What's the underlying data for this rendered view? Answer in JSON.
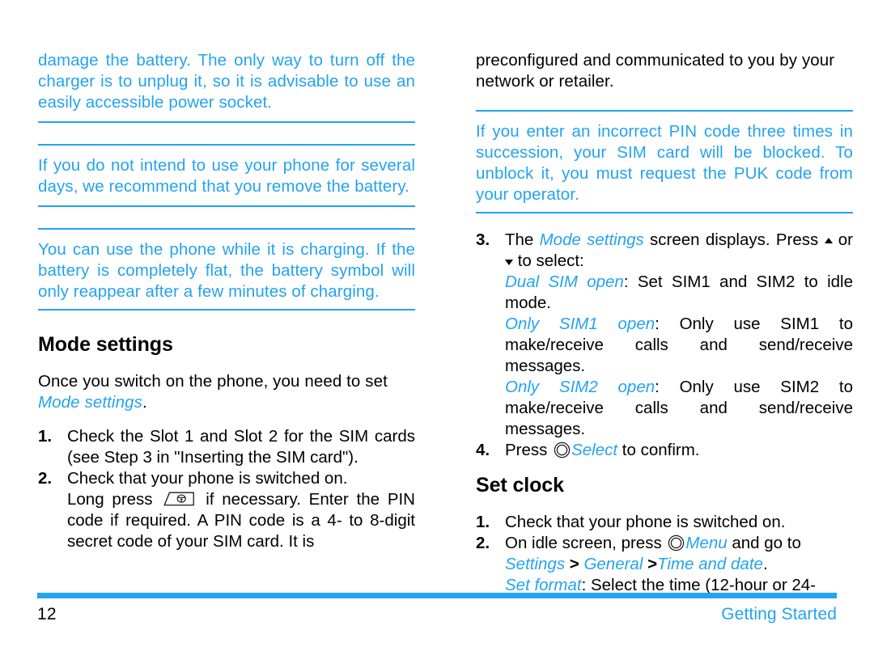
{
  "document": {
    "accent_color": "#23A3F0",
    "text_color": "#000000",
    "page_number": "12",
    "section_label": "Getting Started"
  },
  "left_column": {
    "note_1": "damage the battery. The only way to turn off the charger is to unplug it, so it is advisable to use an easily accessible power socket.",
    "note_2": "If you do not intend to use your phone for several days, we recommend that you remove the battery.",
    "note_3": "You can use the phone while it is charging. If the battery is completely flat, the battery symbol will only reappear after a few minutes of charging.",
    "heading": "Mode settings",
    "intro_part1": "Once you switch on the phone, you need to set ",
    "intro_emphasis": "Mode settings",
    "intro_part2": ".",
    "steps": [
      {
        "number": "1.",
        "text": "Check the Slot 1 and Slot 2 for the SIM cards (see Step 3 in \"Inserting the SIM card\")."
      },
      {
        "number": "2.",
        "line1": "Check that your phone is switched on.",
        "line2_before": "Long press ",
        "line2_icon": "end-call-power-key-icon",
        "line2_after": " if necessary. Enter the PIN code if required. A PIN code is a 4- to 8-digit secret code of your SIM card. It is"
      }
    ]
  },
  "right_column": {
    "para_continued": "preconfigured and communicated to you by your network or retailer.",
    "note_1": "If you enter an incorrect PIN code three times in succession, your SIM card will be blocked. To unblock it, you must request the PUK code from your operator.",
    "steps": [
      {
        "number": "3.",
        "line1_before": "The ",
        "line1_emphasis": "Mode settings",
        "line1_after": " screen displays. Press ",
        "line1_icon_up": "triangle-up-icon",
        "line1_or": " or ",
        "line1_icon_down": "triangle-down-icon",
        "line1_end": " to select:",
        "option1_label": "Dual SIM open",
        "option1_text": ": Set SIM1 and SIM2 to idle mode.",
        "option2_label": "Only SIM1 open",
        "option2_text": ": Only use SIM1 to make/receive calls and send/receive messages.",
        "option3_label": "Only SIM2 open",
        "option3_text": ": Only use SIM2 to make/receive calls and send/receive messages."
      },
      {
        "number": "4.",
        "before": "Press ",
        "icon": "select-softkey-ring-icon",
        "emphasis": "Select",
        "after": " to confirm."
      }
    ],
    "heading": "Set clock",
    "clock_steps": [
      {
        "number": "1.",
        "text": "Check that your phone is switched on."
      },
      {
        "number": "2.",
        "line1_before": "On idle screen, press ",
        "line1_icon": "menu-softkey-ring-icon",
        "line1_emphasis": "Menu",
        "line1_after": " and go to ",
        "path_1": "Settings",
        "path_sep_1": " > ",
        "path_2": "General",
        "path_sep_2": " >",
        "path_3": "Time and date",
        "path_end": ".",
        "format_label": "Set format",
        "format_text": ": Select the time (12-hour or 24-"
      }
    ]
  }
}
